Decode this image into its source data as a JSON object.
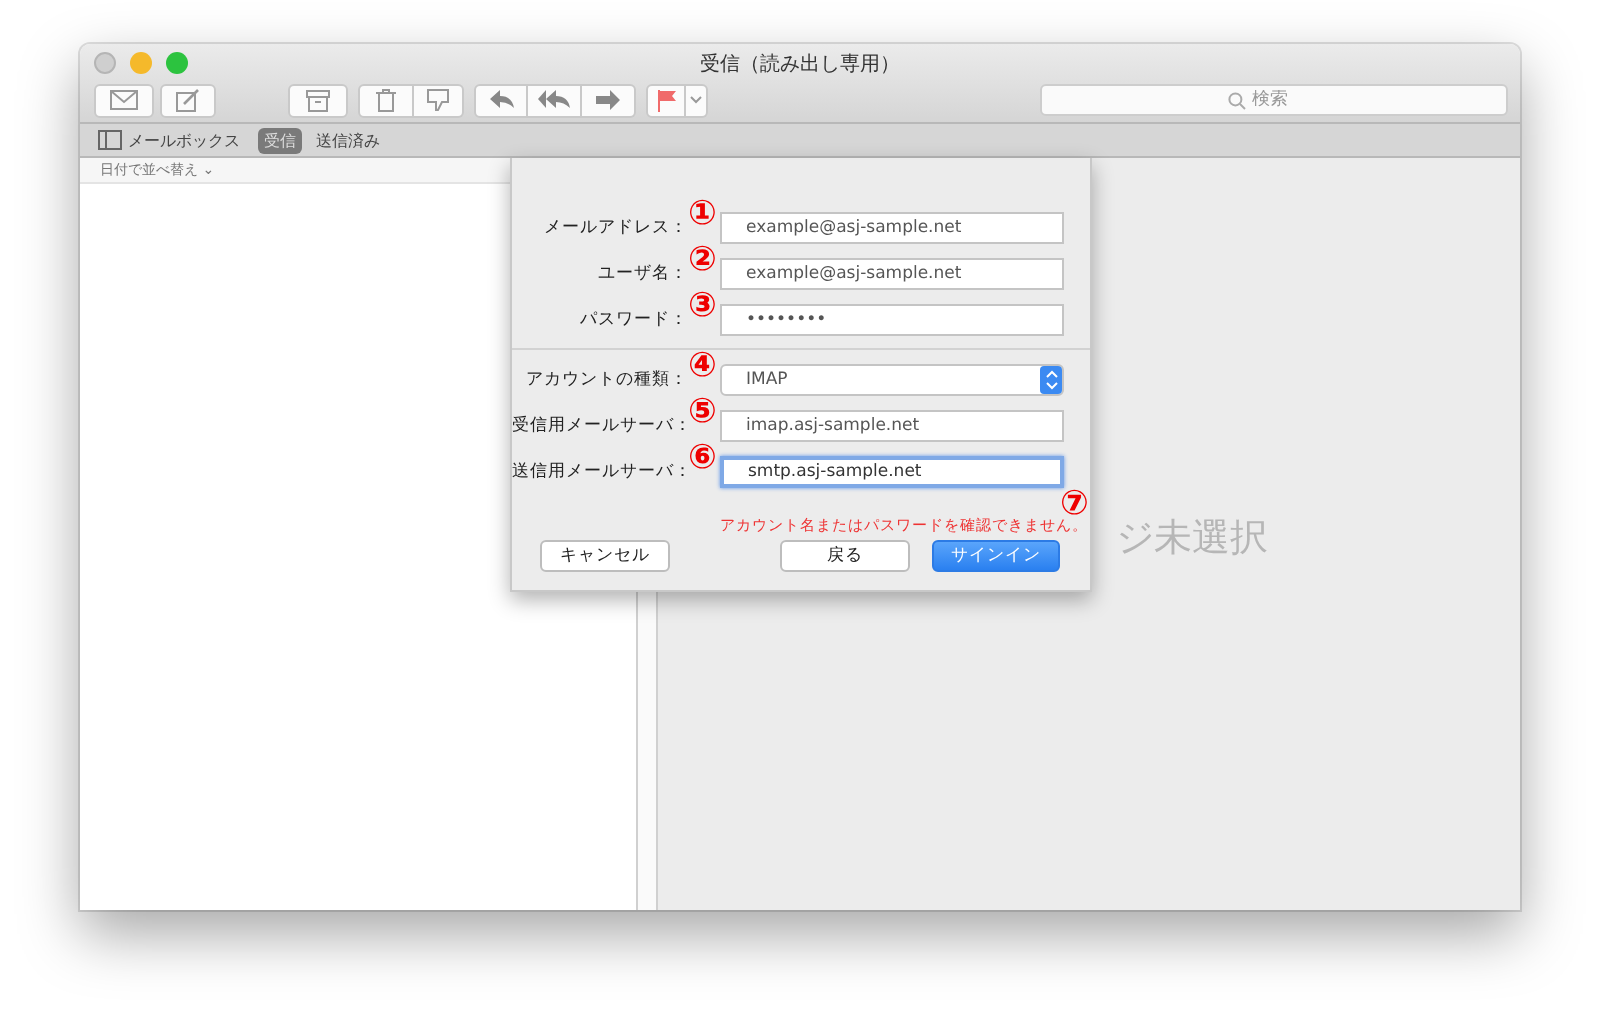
{
  "window": {
    "title": "受信（読み出し専用）"
  },
  "search": {
    "placeholder": "検索"
  },
  "favorites": {
    "mailboxes": "メールボックス",
    "tabs": [
      {
        "label": "受信",
        "selected": true
      },
      {
        "label": "送信済み",
        "selected": false
      }
    ]
  },
  "sort": {
    "label": "日付で並べ替え",
    "caret": "⌄"
  },
  "viewer": {
    "text": "ジ未選択"
  },
  "sheet": {
    "fields": [
      {
        "kind": "text",
        "label": "メールアドレス：",
        "value": "example@asj-sample.net",
        "marker": "①",
        "focused": false
      },
      {
        "kind": "text",
        "label": "ユーザ名：",
        "value": "example@asj-sample.net",
        "marker": "②",
        "focused": false
      },
      {
        "kind": "text",
        "label": "パスワード：",
        "value": "••••••••",
        "marker": "③",
        "focused": false
      },
      {
        "kind": "divider"
      },
      {
        "kind": "popup",
        "label": "アカウントの種類：",
        "value": "IMAP",
        "marker": "④"
      },
      {
        "kind": "text",
        "label": "受信用メールサーバ：",
        "value": "imap.asj-sample.net",
        "marker": "⑤",
        "focused": false
      },
      {
        "kind": "text",
        "label": "送信用メールサーバ：",
        "value": "smtp.asj-sample.net",
        "marker": "⑥",
        "focused": true
      }
    ],
    "error": "アカウント名またはパスワードを確認できません。",
    "error_marker": "⑦",
    "buttons": [
      {
        "label": "キャンセル",
        "kind": "normal"
      },
      {
        "label": "戻る",
        "kind": "normal"
      },
      {
        "label": "サインイン",
        "kind": "default"
      }
    ]
  }
}
